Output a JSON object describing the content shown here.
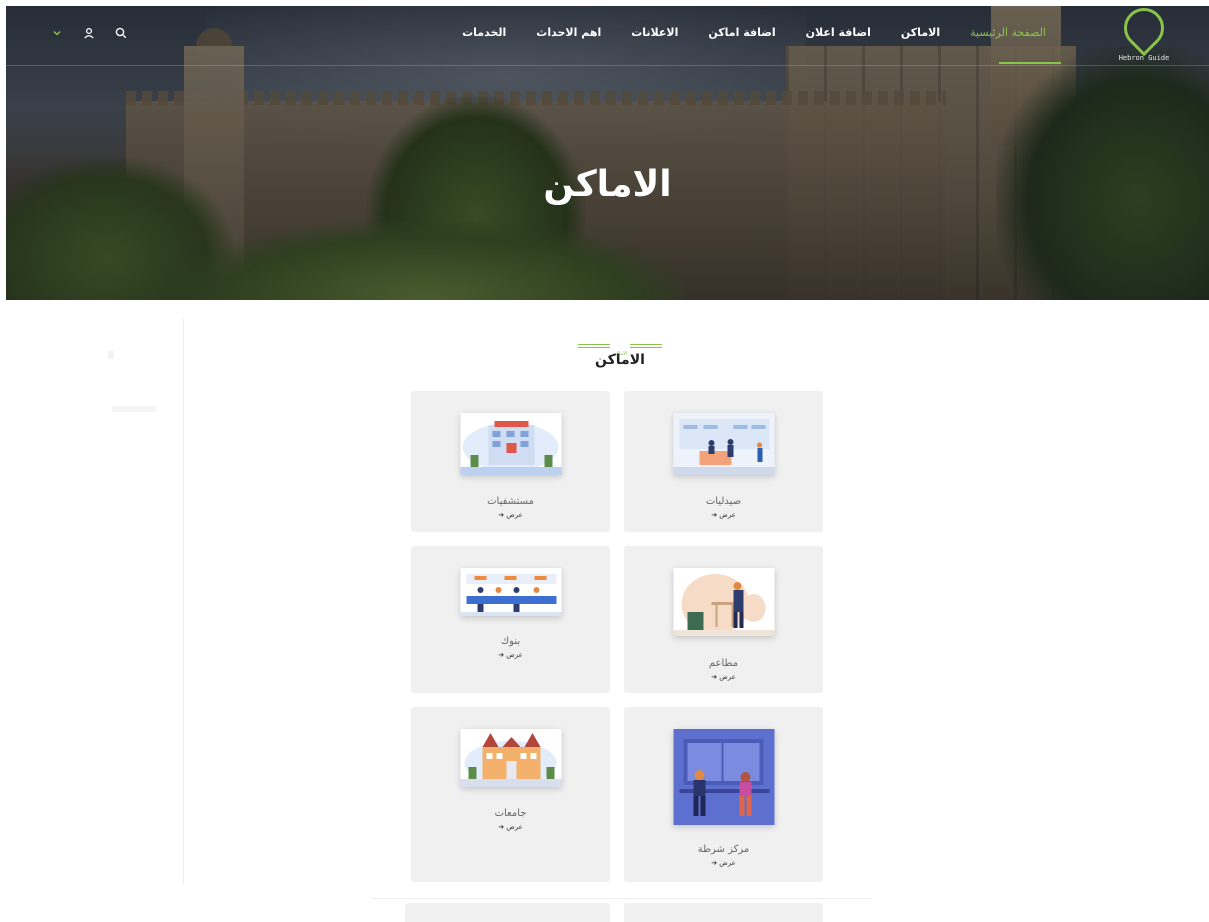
{
  "logo": {
    "text": "Hebron Guide"
  },
  "nav": {
    "items": [
      {
        "label": "الصفحة الرئيسية",
        "active": true
      },
      {
        "label": "الاماكن",
        "active": false
      },
      {
        "label": "اضافة اعلان",
        "active": false
      },
      {
        "label": "اضافة اماكن",
        "active": false
      },
      {
        "label": "الاعلانات",
        "active": false
      },
      {
        "label": "اهم الاحداث",
        "active": false
      },
      {
        "label": "الخدمات",
        "active": false
      }
    ],
    "icons": [
      "search-icon",
      "user-icon",
      "chevron-down-icon"
    ]
  },
  "hero": {
    "title": "الاماكن"
  },
  "section": {
    "kicker": "الاماكن",
    "title": "الاماكن"
  },
  "cards": [
    {
      "name": "صيدليات",
      "view": "عرض ➔"
    },
    {
      "name": "مستشفيات",
      "view": "عرض ➔"
    },
    {
      "name": "مطاعم",
      "view": "عرض ➔"
    },
    {
      "name": "بنوك",
      "view": "عرض ➔"
    },
    {
      "name": "مركز شرطة",
      "view": "عرض ➔"
    },
    {
      "name": "جامعات",
      "view": "عرض ➔"
    }
  ],
  "colors": {
    "accent": "#8bc34a",
    "card_bg": "#f0f0f0"
  }
}
